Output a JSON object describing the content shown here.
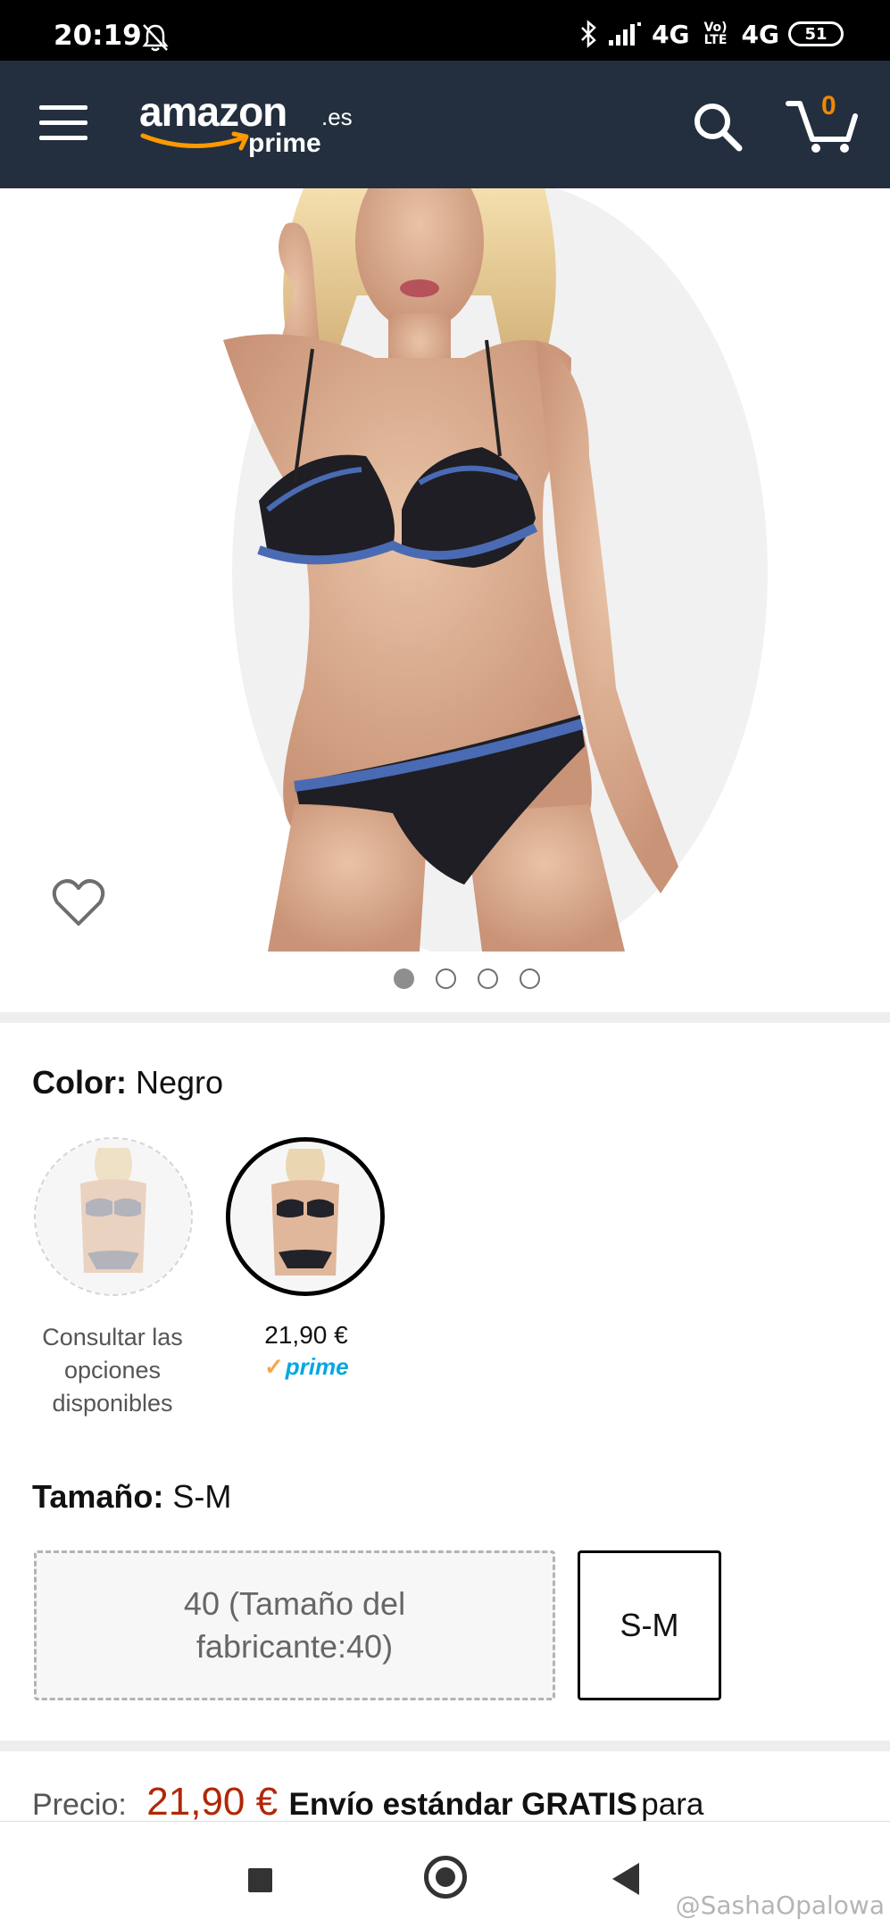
{
  "status_bar": {
    "time": "20:19",
    "right_text": "4G",
    "volte": "Vo) LTE",
    "network": "4G",
    "battery": "51"
  },
  "header": {
    "logo_main": "amazon",
    "logo_domain": ".es",
    "logo_sub": "prime",
    "cart_count": "0",
    "bg_color": "#232f3e"
  },
  "carousel": {
    "dots": 4,
    "active_dot": 1
  },
  "variations": {
    "color_label": "Color:",
    "color_value": "Negro",
    "swatches": [
      {
        "label": "Consultar las opciones disponibles"
      },
      {
        "price": "21,90 €",
        "prime": "prime"
      }
    ],
    "size_label": "Tamaño:",
    "size_value": "S-M",
    "sizes": [
      {
        "label": "40 (Tamaño del fabricante:40)"
      },
      {
        "label": "S-M"
      }
    ]
  },
  "price": {
    "label": "Precio:",
    "value": "21,90 €",
    "shipping": "Envío estándar GRATIS",
    "tail": "para",
    "color": "#b12704"
  },
  "watermark": "@SashaOpalowa"
}
